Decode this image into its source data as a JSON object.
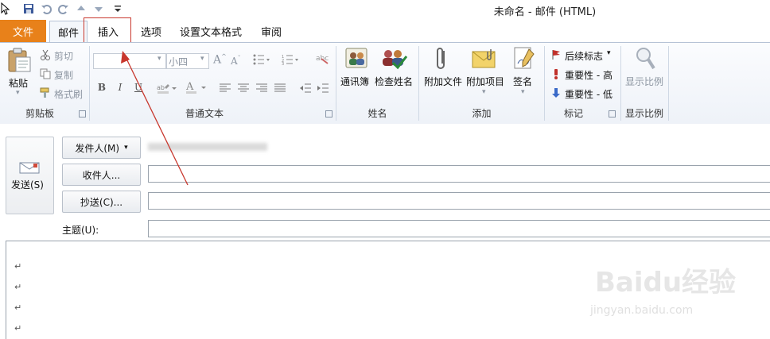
{
  "window": {
    "title": "未命名 - 邮件 (HTML)"
  },
  "quick_access": [
    "cursor-icon",
    "save-icon",
    "undo-icon",
    "redo-icon",
    "up-icon",
    "down-icon",
    "customize-icon"
  ],
  "tabs": {
    "file": "文件",
    "mail": "邮件",
    "insert": "插入",
    "options": "选项",
    "format_text": "设置文本格式",
    "review": "审阅"
  },
  "ribbon": {
    "clipboard": {
      "paste": "粘贴",
      "cut": "剪切",
      "copy": "复制",
      "format_painter": "格式刷",
      "label": "剪贴板"
    },
    "basic_text": {
      "font_size": "小四",
      "label": "普通文本"
    },
    "names": {
      "address_book": "通讯簿",
      "check_names": "检查姓名",
      "label": "姓名"
    },
    "include": {
      "attach_file": "附加文件",
      "attach_item": "附加项目",
      "signature": "签名",
      "label": "添加"
    },
    "tags": {
      "follow_up": "后续标志",
      "high_importance": "重要性 - 高",
      "low_importance": "重要性 - 低",
      "label": "标记"
    },
    "zoom": {
      "zoom": "显示比例",
      "label": "显示比例"
    }
  },
  "compose": {
    "send": "发送(S)",
    "from": "发件人(M)",
    "to": "收件人...",
    "cc": "抄送(C)...",
    "subject": "主题(U):",
    "to_value": "",
    "cc_value": "",
    "subject_value": ""
  },
  "body": {
    "paragraph_mark": "↵"
  },
  "watermark": {
    "brand": "Baidu经验",
    "url": "jingyan.baidu.com"
  },
  "colors": {
    "file_tab": "#e8811a",
    "highlight_box": "#c8372d",
    "ribbon_bg": "#eef2f8"
  }
}
